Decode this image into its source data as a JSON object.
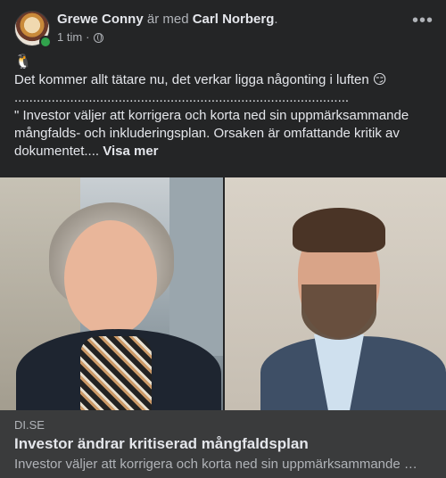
{
  "post": {
    "author_name": "Grewe Conny",
    "with_text": " är med ",
    "tagged_name": "Carl Norberg",
    "tagged_suffix": ".",
    "timestamp": "1 tim",
    "separator": " · ",
    "audience_icon": "globe-icon",
    "more_icon": "more-options-icon",
    "more_glyph": "•••",
    "emoji": "🐧",
    "text_line1": "Det kommer allt tätare nu, det verkar ligga någonting i luften 😏",
    "text_dots": "..........................................................................................",
    "text_quote": "\" Investor väljer att korrigera och korta ned sin uppmärksammande mångfalds- och inkluderingsplan. Orsaken är omfattande kritik av dokumentet.... ",
    "see_more": "Visa mer"
  },
  "link_preview": {
    "domain": "DI.SE",
    "title": "Investor ändrar kritiserad mångfaldsplan",
    "description": "Investor väljer att korrigera och korta ned sin uppmärksammande …"
  },
  "colors": {
    "background": "#242526",
    "preview_background": "#3a3b3c",
    "primary_text": "#e4e6eb",
    "secondary_text": "#b0b3b8",
    "online": "#31a24c"
  }
}
